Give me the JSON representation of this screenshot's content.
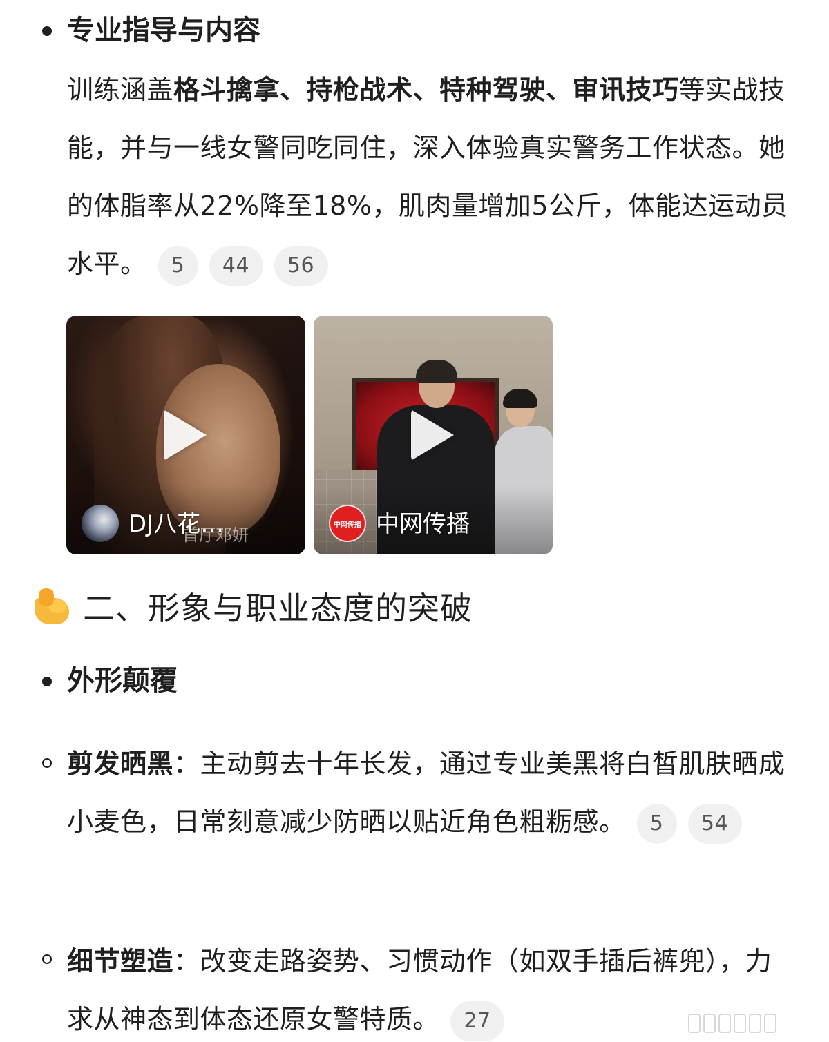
{
  "section1": {
    "bullet_title": "专业指导与内容",
    "para_prefix": "训练涵盖",
    "para_bold": "格斗擒拿、持枪战术、特种驾驶、审讯技巧",
    "para_rest": "等实战技能，并与一线女警同吃同住，深入体验真实警务工作状态。她的体脂率从22%降至18%，肌肉量增加5公斤，体能达运动员水平。",
    "citations": [
      "5",
      "44",
      "56"
    ]
  },
  "videos": [
    {
      "source_name": "DJ八花…",
      "overlay_subtitle": "首厅邓妍",
      "avatar_icon": "dj-avatar-icon"
    },
    {
      "source_name": "中网传播",
      "avatar_label": "中网传播",
      "avatar_icon": "zhongwang-logo-icon"
    }
  ],
  "section2": {
    "heading_icon": "flexed-biceps-emoji-icon",
    "heading": "二、形象与职业态度的突破",
    "bullet_title": "外形颠覆",
    "sub_items": [
      {
        "label": "剪发晒黑",
        "colon": "：",
        "text": "主动剪去十年长发，通过专业美黑将白皙肌肤晒成小麦色，日常刻意减少防晒以贴近角色粗粝感。",
        "citations": [
          "5",
          "54"
        ]
      },
      {
        "label": "细节塑造",
        "colon": "：",
        "text": "改变走路姿势、习惯动作（如双手插后裤兜），力求从神态到体态还原女警特质。",
        "citations": [
          "27"
        ]
      }
    ]
  },
  "colors": {
    "text": "#1f1f1f",
    "citation_bg": "#f0f0f0",
    "citation_text": "#555555",
    "brand_red": "#e02020"
  }
}
